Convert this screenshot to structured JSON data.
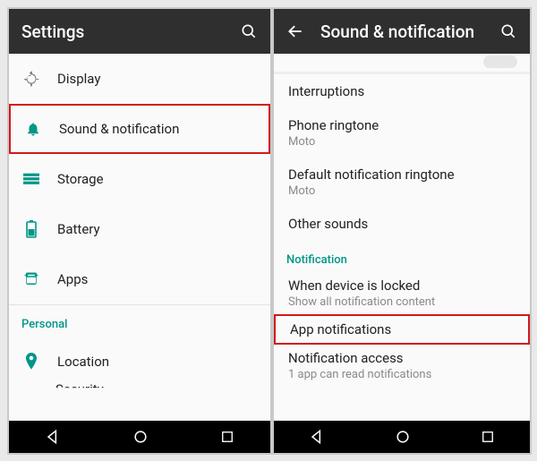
{
  "left": {
    "title": "Settings",
    "items": [
      {
        "icon": "display",
        "label": "Display"
      },
      {
        "icon": "bell",
        "label": "Sound & notification",
        "highlight": true
      },
      {
        "icon": "storage",
        "label": "Storage"
      },
      {
        "icon": "battery",
        "label": "Battery"
      },
      {
        "icon": "apps",
        "label": "Apps"
      }
    ],
    "section": "Personal",
    "personal": [
      {
        "icon": "location",
        "label": "Location"
      }
    ],
    "cutoff": "Security"
  },
  "right": {
    "title": "Sound & notification",
    "prefs_top": [
      {
        "primary": "Interruptions"
      },
      {
        "primary": "Phone ringtone",
        "secondary": "Moto"
      },
      {
        "primary": "Default notification ringtone",
        "secondary": "Moto"
      },
      {
        "primary": "Other sounds"
      }
    ],
    "section": "Notification",
    "prefs_notif": [
      {
        "primary": "When device is locked",
        "secondary": "Show all notification content"
      },
      {
        "primary": "App notifications",
        "highlight": true
      },
      {
        "primary": "Notification access",
        "secondary": "1 app can read notifications"
      }
    ]
  }
}
